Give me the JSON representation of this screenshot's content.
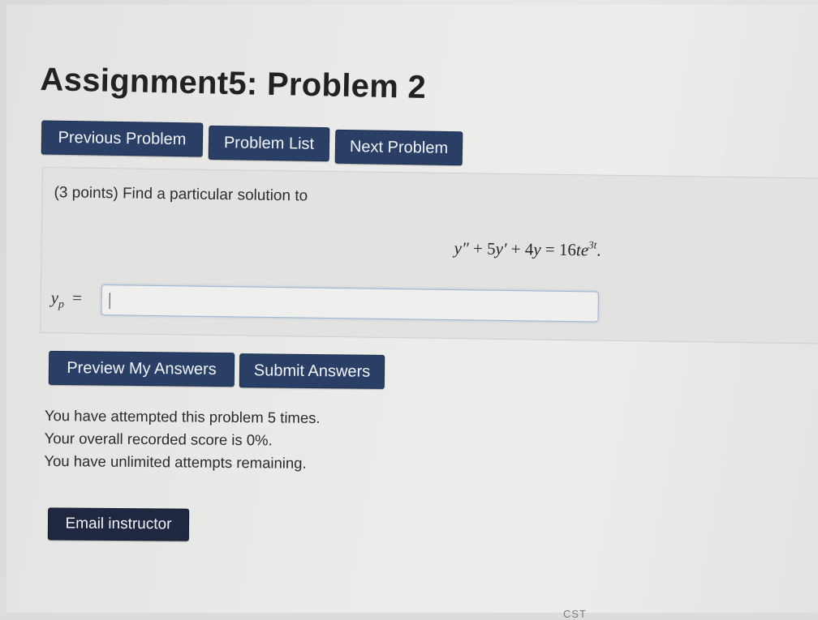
{
  "page": {
    "title": "Assignment5: Problem 2"
  },
  "nav": {
    "previous_label": "Previous Problem",
    "list_label": "Problem List",
    "next_label": "Next Problem"
  },
  "problem": {
    "prompt": "(3 points) Find a particular solution to",
    "equation": {
      "y2": "y″",
      "plus1": " + 5",
      "y1": "y′",
      "plus2": " + 4",
      "y0": "y",
      "equals": " = 16",
      "te": "te",
      "exp": "3t",
      "period": "."
    },
    "answer_label_var": "y",
    "answer_label_sub": "p",
    "answer_label_eq": "=",
    "answer_value": ""
  },
  "actions": {
    "preview_label": "Preview My Answers",
    "submit_label": "Submit Answers"
  },
  "status": {
    "attempts": "You have attempted this problem 5 times.",
    "score": "Your overall recorded score is 0%.",
    "remaining": "You have unlimited attempts remaining."
  },
  "email": {
    "label": "Email instructor"
  },
  "footer": {
    "fragment": "CST"
  },
  "colors": {
    "button_bg": "#2a3f66",
    "email_button_bg": "#1f2840",
    "input_border": "#9cb6d6"
  }
}
